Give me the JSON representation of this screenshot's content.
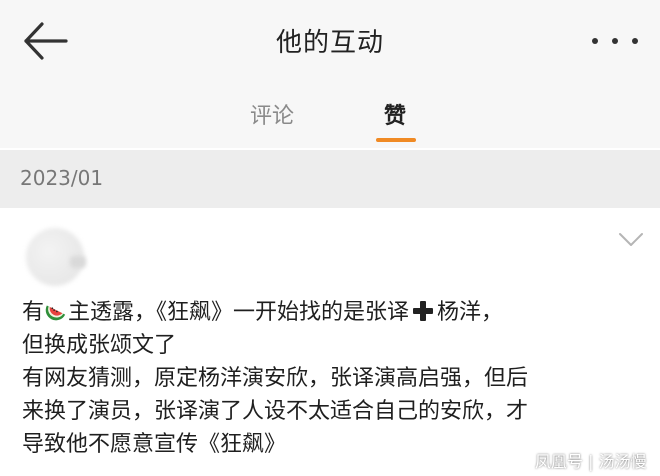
{
  "header": {
    "title": "他的互动",
    "back_icon": "back-arrow-icon",
    "more_icon": "more-dots-icon"
  },
  "tabs": [
    {
      "label": "评论",
      "active": false
    },
    {
      "label": "赞",
      "active": true
    }
  ],
  "accent_color": "#f08a24",
  "date_section": "2023/01",
  "post": {
    "line1_a": "有",
    "line1_b": "主透露，《狂飙》一开始找的是张译",
    "line1_c": "杨洋，",
    "line2": "但换成张颂文了",
    "line3": "有网友猜测，原定杨洋演安欣，张译演高启强，但后",
    "line4": "来换了演员，张译演了人设不太适合自己的安欣，才",
    "line5": "导致他不愿意宣传《狂飙》",
    "emoji_1": "watermelon-icon",
    "emoji_2": "plus-icon"
  },
  "watermark": "凤凰号 | 汤汤慢"
}
